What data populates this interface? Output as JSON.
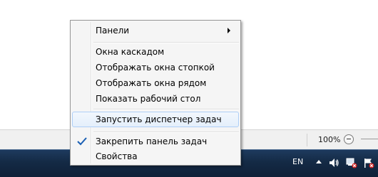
{
  "status_bar": {
    "zoom_label": "100%"
  },
  "taskbar": {
    "language": "EN",
    "tray_icons": [
      "show-hidden-icons-arrow",
      "volume-icon",
      "network-icon",
      "action-center-flag-icon"
    ]
  },
  "context_menu": {
    "items": [
      {
        "label": "Панели",
        "has_submenu": true
      },
      {
        "label": "Окна каскадом"
      },
      {
        "label": "Отображать окна стопкой"
      },
      {
        "label": "Отображать окна рядом"
      },
      {
        "label": "Показать рабочий стол"
      },
      {
        "label": "Запустить диспетчер задач",
        "highlighted": true
      },
      {
        "label": "Закрепить панель задач",
        "checked": true
      },
      {
        "label": "Свойства"
      }
    ]
  },
  "colors": {
    "menu_background": "#f5f5f5",
    "menu_highlight": "#e4effb",
    "taskbar": "#142a45",
    "check_mark": "#1a5fb4"
  }
}
